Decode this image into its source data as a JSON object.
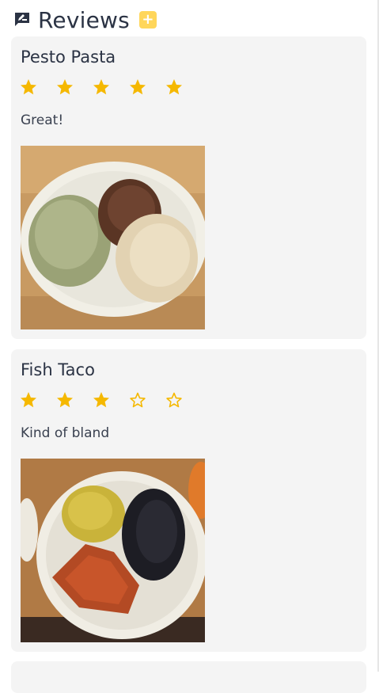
{
  "header": {
    "icon": "rate-review-icon",
    "title": "Reviews",
    "add_icon": "plus-icon",
    "accent": "#ffd65a"
  },
  "reviews": [
    {
      "dish": "Pesto Pasta",
      "rating": 5,
      "max_rating": 5,
      "comment": "Great!",
      "photo": "pasta-plate-photo"
    },
    {
      "dish": "Fish Taco",
      "rating": 3,
      "max_rating": 5,
      "comment": "Kind of bland",
      "photo": "fish-plate-photo"
    }
  ],
  "colors": {
    "star": "#f5b800",
    "card_bg": "#f4f4f4",
    "text": "#2b3344"
  }
}
